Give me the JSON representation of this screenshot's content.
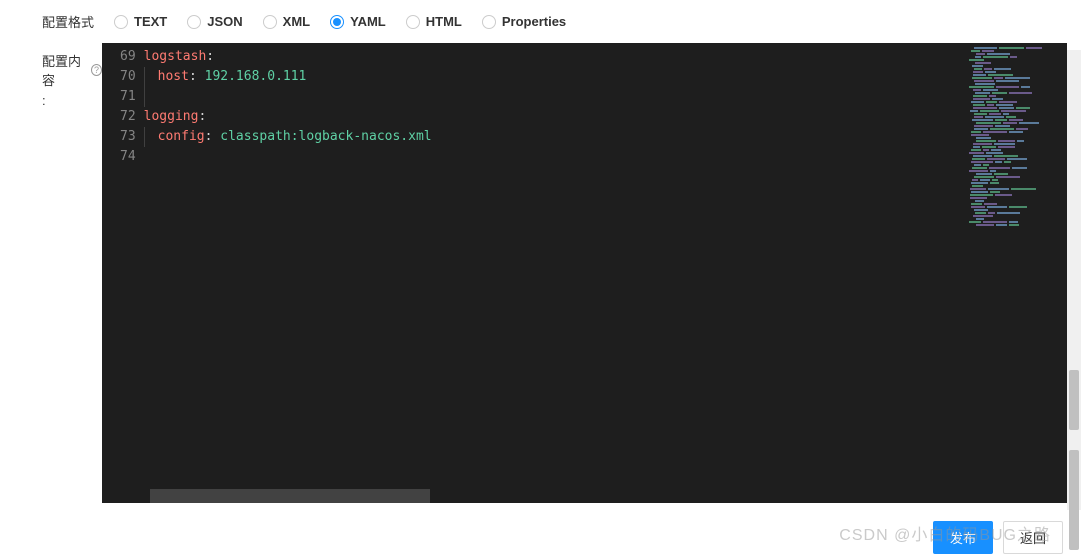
{
  "format": {
    "label": "配置格式",
    "options": [
      {
        "value": "TEXT",
        "selected": false
      },
      {
        "value": "JSON",
        "selected": false
      },
      {
        "value": "XML",
        "selected": false
      },
      {
        "value": "YAML",
        "selected": true
      },
      {
        "value": "HTML",
        "selected": false
      },
      {
        "value": "Properties",
        "selected": false
      }
    ]
  },
  "content": {
    "label": "配置内容",
    "colon": ":",
    "help": "?"
  },
  "editor": {
    "lines": [
      {
        "num": "69",
        "tokens": [
          {
            "t": "key",
            "v": "logstash"
          },
          {
            "t": "colon",
            "v": ":"
          }
        ],
        "indent": 0
      },
      {
        "num": "70",
        "tokens": [
          {
            "t": "key",
            "v": "host"
          },
          {
            "t": "colon",
            "v": ": "
          },
          {
            "t": "value",
            "v": "192.168.0.111"
          }
        ],
        "indent": 1
      },
      {
        "num": "71",
        "tokens": [],
        "indent": 1
      },
      {
        "num": "72",
        "tokens": [
          {
            "t": "key",
            "v": "logging"
          },
          {
            "t": "colon",
            "v": ":"
          }
        ],
        "indent": 0
      },
      {
        "num": "73",
        "tokens": [
          {
            "t": "key",
            "v": "config"
          },
          {
            "t": "colon",
            "v": ": "
          },
          {
            "t": "value",
            "v": "classpath:logback-nacos.xml"
          }
        ],
        "indent": 1
      },
      {
        "num": "74",
        "tokens": [],
        "indent": 0
      }
    ]
  },
  "footer": {
    "publish": "发布",
    "back": "返回"
  },
  "watermark": "CSDN @小白的码BUG之路"
}
